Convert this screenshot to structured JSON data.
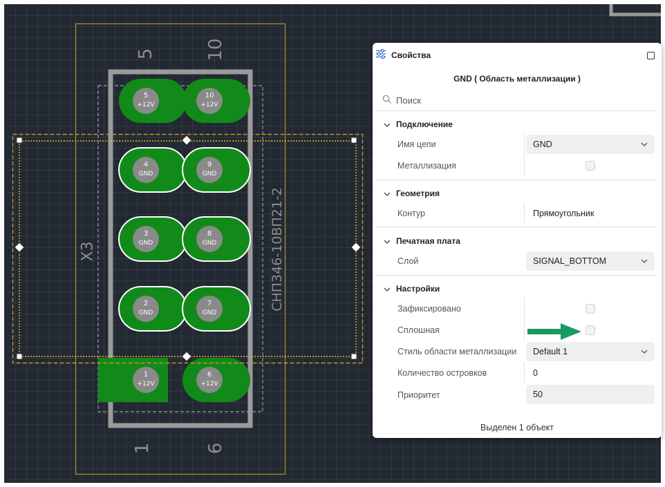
{
  "pcb": {
    "component_ref": "X3",
    "component_value": "СНП346-10ВП21-2",
    "column_numbers": {
      "top_left": "5",
      "top_right": "10",
      "bottom_left": "1",
      "bottom_right": "6"
    },
    "pads": [
      {
        "num": "5",
        "net": "+12V"
      },
      {
        "num": "10",
        "net": "+12V"
      },
      {
        "num": "4",
        "net": "GND"
      },
      {
        "num": "9",
        "net": "GND"
      },
      {
        "num": "3",
        "net": "GND"
      },
      {
        "num": "8",
        "net": "GND"
      },
      {
        "num": "2",
        "net": "GND"
      },
      {
        "num": "7",
        "net": "GND"
      },
      {
        "num": "1",
        "net": "+12V"
      },
      {
        "num": "6",
        "net": "+12V"
      }
    ],
    "colors": {
      "background": "#232933",
      "pad": "#118a1a",
      "pad_label_circle": "#8a8a8a",
      "outline": "#9a9a9a",
      "courtyard": "#a88f2a",
      "selection": "#c7922a"
    }
  },
  "panel": {
    "title": "Свойства",
    "subtitle": "GND ( Область металлизации )",
    "search_placeholder": "Поиск",
    "sections": {
      "connection": {
        "title": "Подключение",
        "net_name_label": "Имя цепи",
        "net_name_value": "GND",
        "plating_label": "Металлизация",
        "plating_checked": false
      },
      "geometry": {
        "title": "Геометрия",
        "contour_label": "Контур",
        "contour_value": "Прямоугольник"
      },
      "pcb": {
        "title": "Печатная плата",
        "layer_label": "Слой",
        "layer_value": "SIGNAL_BOTTOM"
      },
      "settings": {
        "title": "Настройки",
        "locked_label": "Зафиксировано",
        "locked_checked": false,
        "solid_label": "Сплошная",
        "solid_checked": false,
        "style_label": "Стиль области металлизации",
        "style_value": "Default 1",
        "islands_label": "Количество островков",
        "islands_value": "0",
        "priority_label": "Приоритет",
        "priority_value": "50"
      }
    },
    "footer": "Выделен 1 объект"
  },
  "annotation": {
    "arrow_color": "#1a9a63"
  }
}
